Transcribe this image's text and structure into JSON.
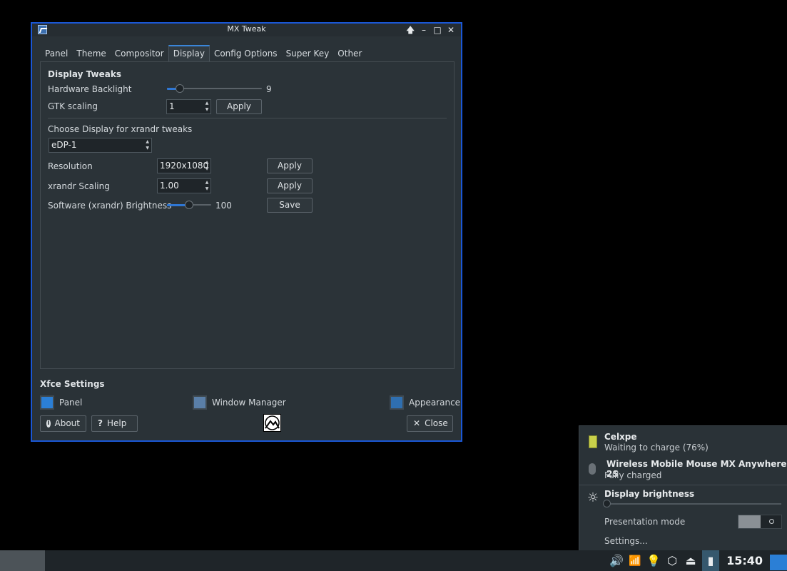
{
  "window": {
    "title": "MX Tweak",
    "controls": [
      "🡅",
      "–",
      "□",
      "✕"
    ]
  },
  "tabs": [
    "Panel",
    "Theme",
    "Compositor",
    "Display",
    "Config Options",
    "Super Key",
    "Other"
  ],
  "active_tab": "Display",
  "display": {
    "section_title": "Display Tweaks",
    "backlight_label": "Hardware Backlight",
    "backlight_value": "9",
    "backlight_fraction": 0.1,
    "gtk_label": "GTK scaling",
    "gtk_value": "1",
    "apply_label": "Apply",
    "choose_label": "Choose Display for xrandr tweaks",
    "display_selected": "eDP-1",
    "resolution_label": "Resolution",
    "resolution_value": "1920x1080",
    "xrandr_label": "xrandr Scaling",
    "xrandr_value": "1.00",
    "brightness_label": "Software (xrandr) Brightness",
    "brightness_value": "100",
    "brightness_fraction": 0.5,
    "save_label": "Save"
  },
  "xfce": {
    "title": "Xfce Settings",
    "panel": "Panel",
    "wm": "Window Manager",
    "appearance": "Appearance"
  },
  "bottom": {
    "about": "About",
    "help": "Help",
    "close": "Close"
  },
  "popup": {
    "battery_title": "Celxpe",
    "battery_status": "Waiting to charge (76%)",
    "mouse_title": "Wireless Mobile Mouse MX Anywhere 2S",
    "mouse_status": "Fully charged",
    "brightness_title": "Display brightness",
    "presentation": "Presentation mode",
    "settings": "Settings..."
  },
  "taskbar": {
    "clock": "15:40"
  },
  "colors": {
    "accent": "#1a57d6",
    "slider_fill": "#2f77d4",
    "background": "#2a3237"
  }
}
